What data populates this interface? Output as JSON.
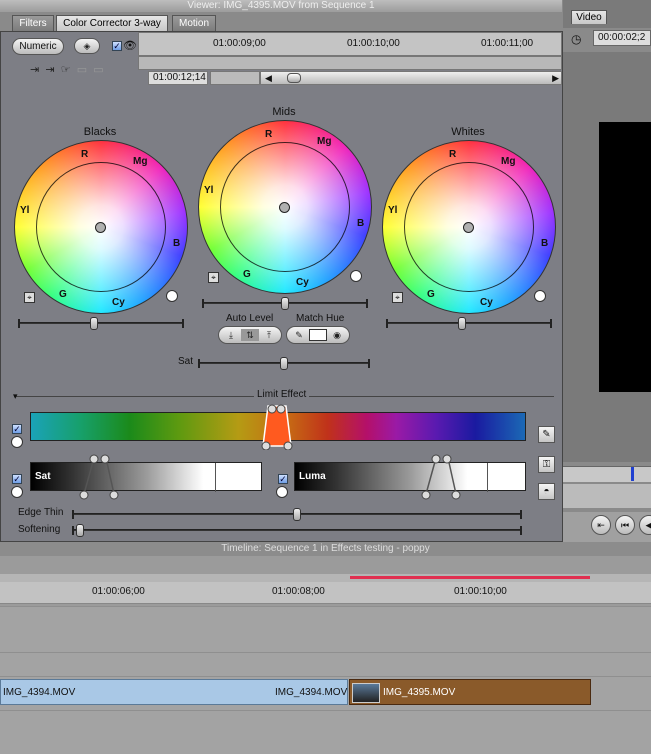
{
  "viewer": {
    "title": "Viewer: IMG_4395.MOV from Sequence 1",
    "tabs": [
      {
        "label": "Filters",
        "active": false
      },
      {
        "label": "Color Corrector 3-way",
        "active": true
      },
      {
        "label": "Motion",
        "active": false
      }
    ],
    "numeric_label": "Numeric",
    "ruler_times": [
      "01:00:09;00",
      "01:00:10;00",
      "01:00:11;00"
    ],
    "current_timecode": "01:00:12;14"
  },
  "color_corrector": {
    "wheels": [
      {
        "label": "Blacks"
      },
      {
        "label": "Mids"
      },
      {
        "label": "Whites"
      }
    ],
    "wheel_hue_labels": {
      "r": "R",
      "mg": "Mg",
      "b": "B",
      "cy": "Cy",
      "g": "G",
      "yl": "Yl"
    },
    "auto_level_label": "Auto Level",
    "match_hue_label": "Match Hue",
    "sat_label": "Sat",
    "limit_effect_label": "Limit Effect",
    "sat_bar_label": "Sat",
    "luma_bar_label": "Luma",
    "edge_thin_label": "Edge Thin",
    "softening_label": "Softening",
    "slider_levels": {
      "blacks_balance": 0.45,
      "mids_balance": 0.5,
      "whites_balance": 0.45,
      "sat": 0.5,
      "edge_thin": 0.5,
      "softening": 0.0
    }
  },
  "video_viewer": {
    "tab_label": "Video",
    "timecode": "00:00:02;2"
  },
  "timeline": {
    "title": "Timeline: Sequence 1 in Effects testing - poppy",
    "ruler_times": [
      "01:00:06;00",
      "01:00:08;00",
      "01:00:10;00"
    ],
    "clips": [
      {
        "name": "IMG_4394.MOV",
        "name_end": "IMG_4394.MOV",
        "color": "#a8c8e8"
      },
      {
        "name": "IMG_4395.MOV",
        "color": "#8a5a2a"
      }
    ]
  }
}
